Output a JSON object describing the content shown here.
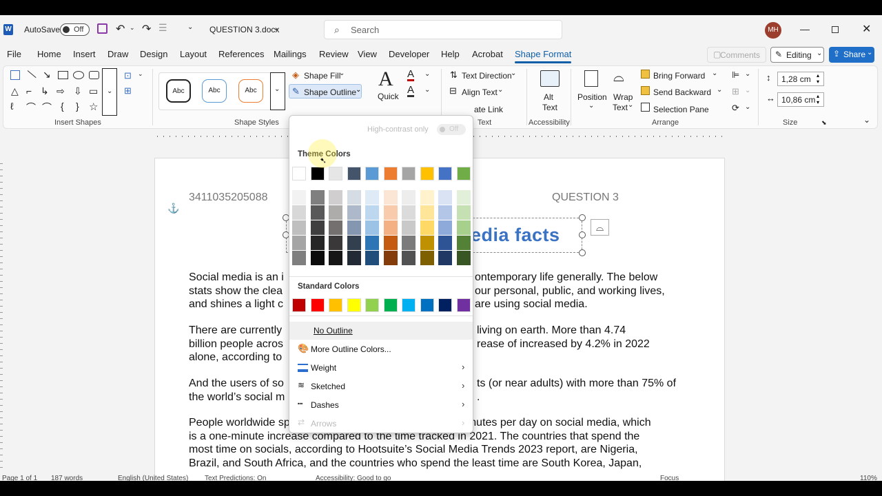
{
  "titlebar": {
    "autosave_label": "AutoSave",
    "autosave_state": "Off",
    "filename": "QUESTION 3.docx",
    "search_placeholder": "Search",
    "avatar_initials": "MH"
  },
  "tabs": [
    "File",
    "Home",
    "Insert",
    "Draw",
    "Design",
    "Layout",
    "References",
    "Mailings",
    "Review",
    "View",
    "Developer",
    "Help",
    "Acrobat",
    "Shape Format"
  ],
  "active_tab": "Shape Format",
  "right_buttons": {
    "comments": "Comments",
    "editing": "Editing",
    "share": "Share"
  },
  "ribbon": {
    "groups": {
      "insert_shapes": "Insert Shapes",
      "shape_styles": "Shape Styles",
      "text": "Text",
      "accessibility": "Accessibility",
      "arrange": "Arrange",
      "size": "Size"
    },
    "style_presets": [
      "Abc",
      "Abc",
      "Abc"
    ],
    "shape_fill": "Shape Fill",
    "shape_outline": "Shape Outline",
    "quick": "Quick",
    "text_direction": "Text Direction",
    "align_text": "Align Text",
    "create_link": "ate Link",
    "alt_text": [
      "Alt",
      "Text"
    ],
    "position": "Position",
    "wrap_text": [
      "Wrap",
      "Text"
    ],
    "bring_forward": "Bring Forward",
    "send_backward": "Send Backward",
    "selection_pane": "Selection Pane",
    "height": "1,28 cm",
    "width": "10,86 cm"
  },
  "document": {
    "header_left": "3411035205088",
    "header_right": "QUESTION 3",
    "wordart": "edia facts",
    "p1": [
      {
        "a": "Social media is an i",
        "b": "ontemporary life generally. The below"
      },
      {
        "a": "stats show the clea",
        "b": "our personal, public, and working lives,"
      },
      {
        "a": "and shines a light c",
        "b": "are using social media."
      }
    ],
    "p2": [
      {
        "a": "There are currently",
        "b": "living on earth. More than 4.74"
      },
      {
        "a": "billion people acros",
        "b": "rease of increased by 4.2% in 2022"
      },
      {
        "a": "alone, according to",
        "b": ""
      }
    ],
    "p3": [
      {
        "a": "And the users of so",
        "b": "ts (or near adults) with more than 75% of"
      },
      {
        "a": "the world’s social m",
        "b": "."
      }
    ],
    "p4": [
      "People worldwide spend an average of 2 hours and 28 minutes per day on social media, which",
      "is a one-minute increase compared to the time tracked in 2021. The countries that spend the",
      "most time on socials, according to Hootsuite’s Social Media Trends 2023 report, are Nigeria,",
      "Brazil, and South Africa, and the countries who spend the least time are South Korea, Japan,"
    ]
  },
  "dropdown": {
    "high_contrast": "High-contrast only",
    "high_contrast_state": "Off",
    "theme_colors_label": "Theme Colors",
    "theme_top": [
      "#ffffff",
      "#000000",
      "#e7e6e6",
      "#44546a",
      "#5b9bd5",
      "#ed7d31",
      "#a5a5a5",
      "#ffc000",
      "#4472c4",
      "#70ad47"
    ],
    "theme_shades": [
      [
        "#f2f2f2",
        "#7f7f7f",
        "#d0cece",
        "#d6dce4",
        "#deebf6",
        "#fbe5d5",
        "#ededed",
        "#fff2cc",
        "#dae3f3",
        "#e2efd9"
      ],
      [
        "#d8d8d8",
        "#595959",
        "#aeabab",
        "#adb9ca",
        "#bdd7ee",
        "#f7cbac",
        "#dbdbdb",
        "#fee599",
        "#b4c6e7",
        "#c5e0b3"
      ],
      [
        "#bfbfbf",
        "#3f3f3f",
        "#757070",
        "#8496b0",
        "#9cc3e5",
        "#f4b183",
        "#c9c9c9",
        "#ffd965",
        "#8eaadb",
        "#a8d08d"
      ],
      [
        "#a5a5a5",
        "#262626",
        "#3a3838",
        "#323f4f",
        "#2e75b5",
        "#c55a11",
        "#7b7b7b",
        "#bf9000",
        "#2f5496",
        "#538135"
      ],
      [
        "#7f7f7f",
        "#0c0c0c",
        "#171616",
        "#222a35",
        "#1e4e79",
        "#843c0b",
        "#525252",
        "#7f6000",
        "#1f3864",
        "#375623"
      ]
    ],
    "standard_colors_label": "Standard Colors",
    "standard": [
      "#c00000",
      "#ff0000",
      "#ffc000",
      "#ffff00",
      "#92d050",
      "#00b050",
      "#00b0f0",
      "#0070c0",
      "#002060",
      "#7030a0"
    ],
    "items": {
      "no_outline": "No Outline",
      "more_colors": "More Outline Colors...",
      "weight": "Weight",
      "sketched": "Sketched",
      "dashes": "Dashes",
      "arrows": "Arrows"
    }
  },
  "statusbar": {
    "page": "Page 1 of 1",
    "words": "187 words",
    "language": "English (United States)",
    "predictions": "Text Predictions: On",
    "accessibility": "Accessibility: Good to go",
    "focus": "Focus",
    "zoom": "110%"
  },
  "colors": {
    "accent": "#0f5ea8",
    "share_bg": "#1f6fc9",
    "wordart": "#3a72c4"
  }
}
